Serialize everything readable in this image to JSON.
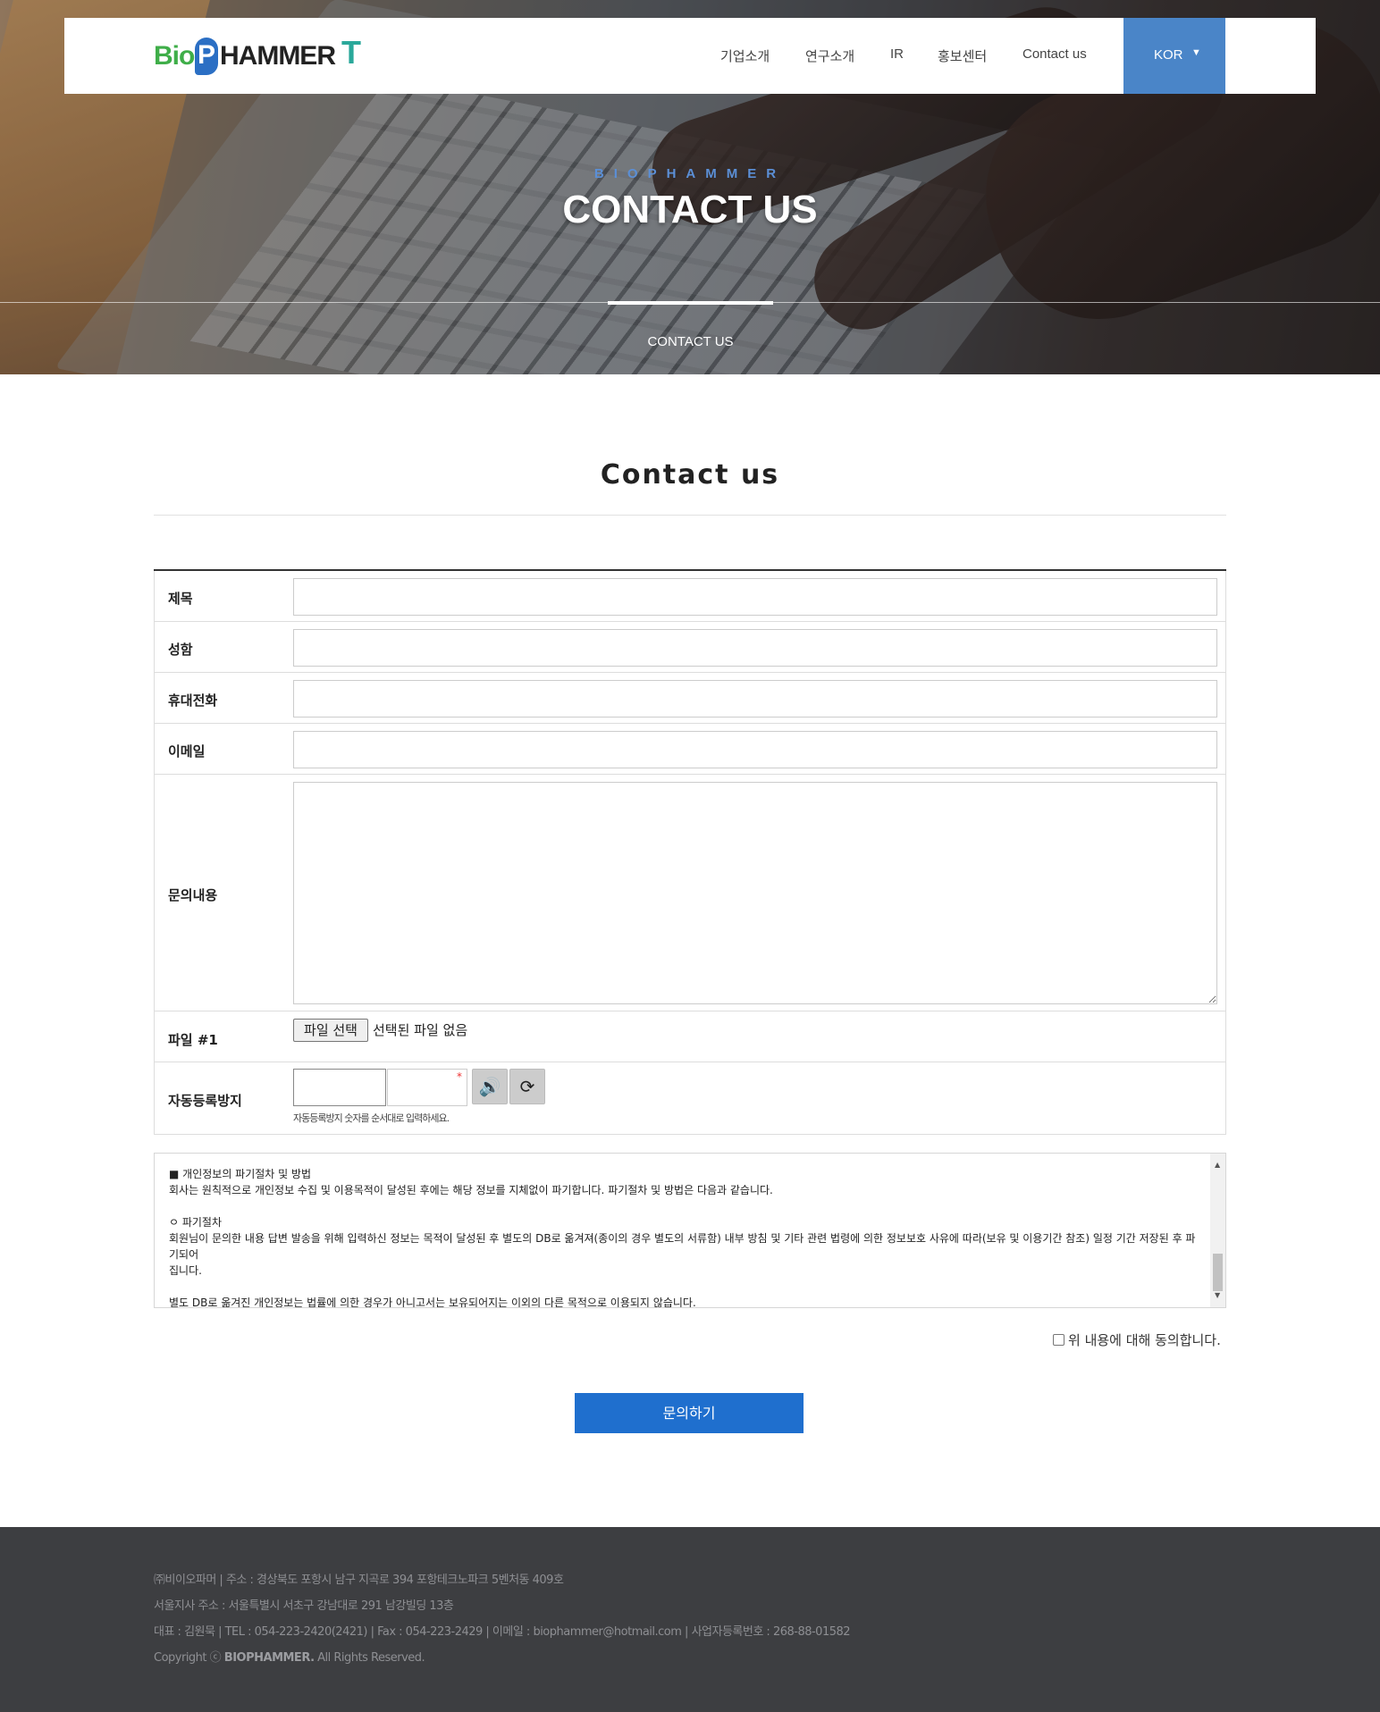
{
  "header": {
    "logo_text": "BioPHAMMERT",
    "menu": [
      {
        "label": "기업소개"
      },
      {
        "label": "연구소개"
      },
      {
        "label": "IR"
      },
      {
        "label": "홍보센터"
      },
      {
        "label": "Contact us"
      }
    ],
    "language": {
      "label": "KOR",
      "arrow": "▼"
    }
  },
  "hero": {
    "subtitle": "BIOPHAMMER",
    "title": "CONTACT US",
    "tab": "CONTACT US"
  },
  "page": {
    "title": "Contact us"
  },
  "form": {
    "subject_label": "제목",
    "name_label": "성함",
    "phone_label": "휴대전화",
    "email_label": "이메일",
    "message_label": "문의내용",
    "file_label": "파일 #1",
    "file_button": "파일 선택",
    "file_status": "선택된 파일 없음",
    "captcha_label": "자동등록방지",
    "captcha_required_mark": "*",
    "captcha_hint": "자동등록방지 숫자를 순서대로 입력하세요."
  },
  "privacy": {
    "lines": [
      "■ 개인정보의 파기절차 및 방법",
      " 회사는 원칙적으로 개인정보 수집 및 이용목적이 달성된 후에는 해당 정보를 지체없이 파기합니다. 파기절차 및 방법은 다음과 같습니다.",
      "",
      "ㅇ 파기절차",
      " 회원님이 문의한 내용 답변 발송을 위해 입력하신 정보는 목적이 달성된 후 별도의 DB로 옮겨져(종이의 경우 별도의 서류함) 내부 방침 및 기타 관련 법령에 의한 정보보호 사유에 따라(보유 및 이용기간 참조) 일정 기간 저장된 후 파기되어",
      "집니다.",
      "",
      "별도 DB로 옮겨진 개인정보는 법률에 의한 경우가 아니고서는 보유되어지는 이외의 다른 목적으로 이용되지 않습니다."
    ]
  },
  "agree_label": "위 내용에 대해 동의합니다.",
  "submit_label": "문의하기",
  "footer": {
    "line1": "㈜비이오파머    |    주소 : 경상북도 포항시 남구 지곡로 394 포항테크노파크 5벤처동 409호",
    "line2": "서울지사 주소 : 서울특별시 서초구 강남대로 291 남강빌딩 13층",
    "line3": "대표 : 김원묵    |    TEL : 054-223-2420(2421)    |    Fax : 054-223-2429    |    이메일 : biophammer@hotmail.com    |    사업자등록번호 : 268-88-01582",
    "copyright_prefix": "Copyright ⓒ ",
    "copyright_brand": "BIOPHAMMER.",
    "copyright_suffix": " All Rights Reserved."
  },
  "colors": {
    "accent": "#1f6fce",
    "lang_bg": "#4a85c8",
    "footer_bg": "#3d3e41"
  }
}
